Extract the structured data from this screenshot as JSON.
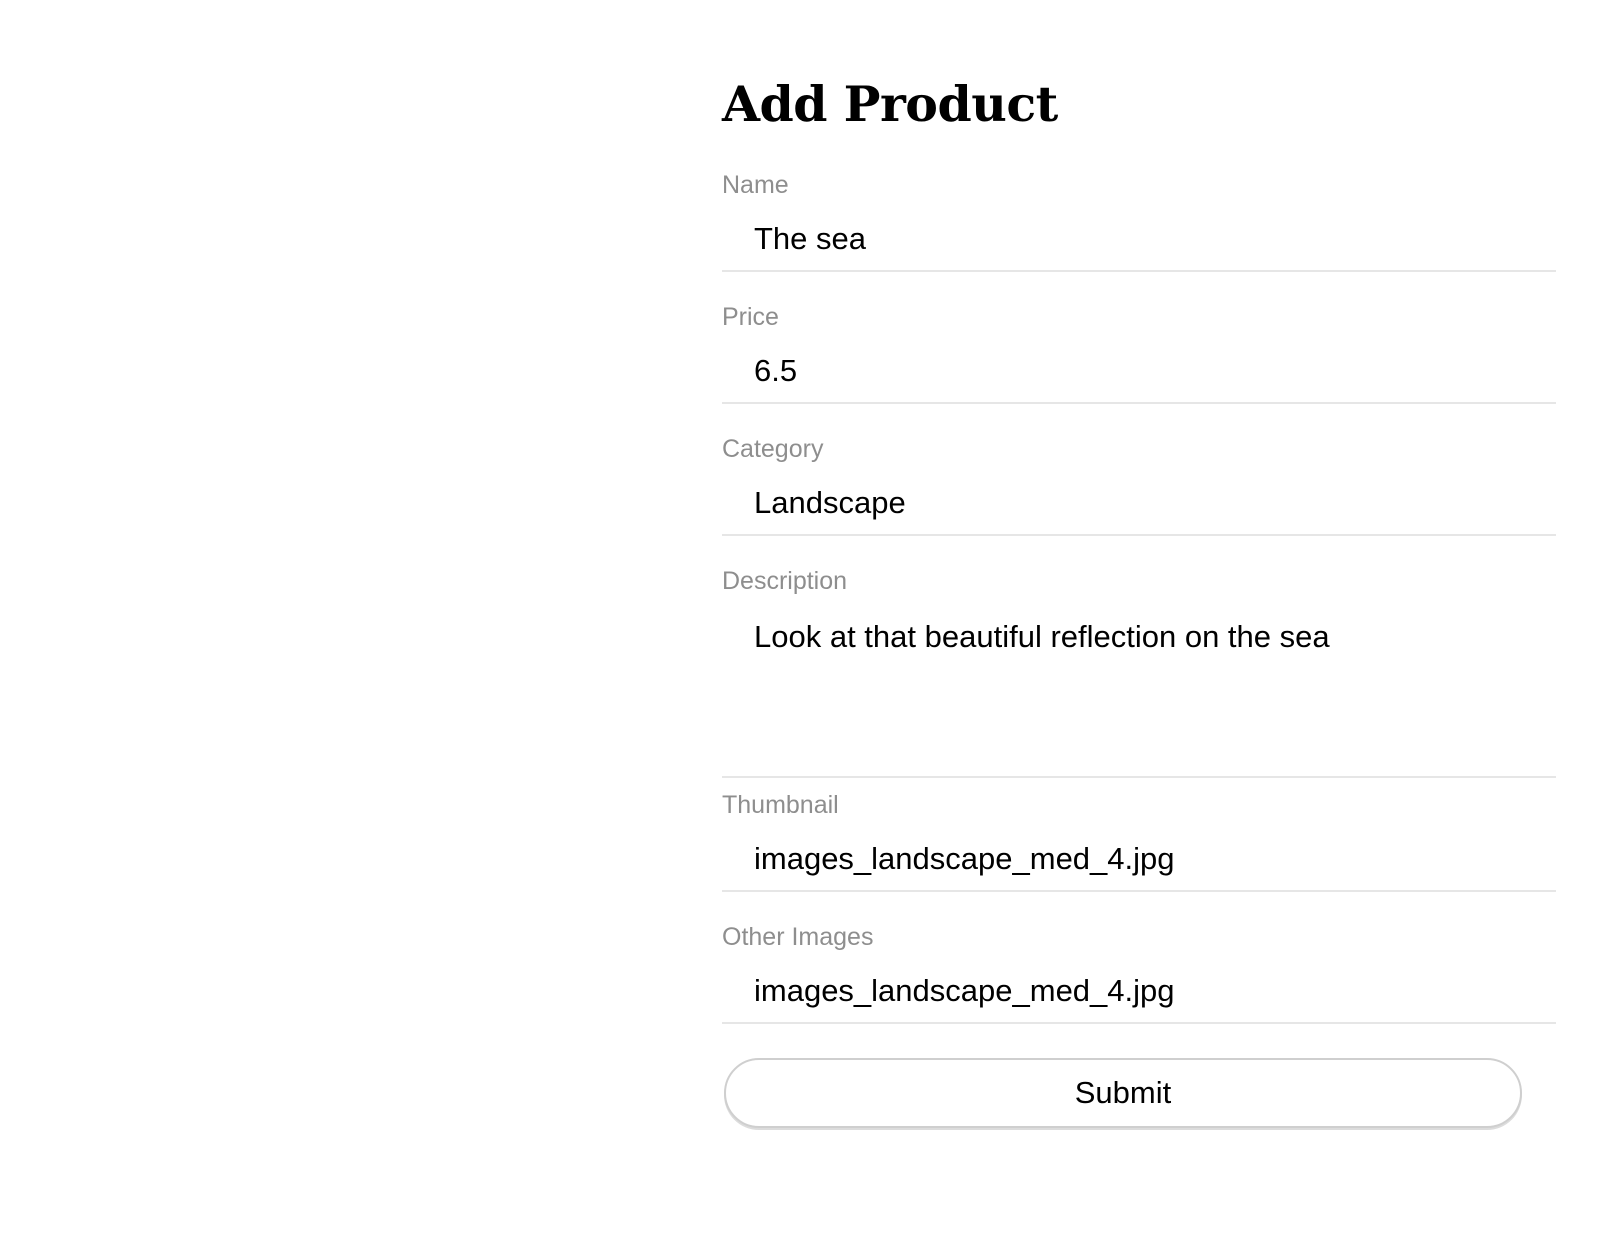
{
  "form": {
    "title": "Add Product",
    "fields": [
      {
        "label": "Name",
        "value": "The sea"
      },
      {
        "label": "Price",
        "value": "6.5"
      },
      {
        "label": "Category",
        "value": "Landscape"
      },
      {
        "label": "Description",
        "value": "Look at that beautiful reflection on the sea"
      },
      {
        "label": "Thumbnail",
        "value": "images_landscape_med_4.jpg"
      },
      {
        "label": "Other Images",
        "value": "images_landscape_med_4.jpg"
      }
    ],
    "submit_label": "Submit"
  }
}
